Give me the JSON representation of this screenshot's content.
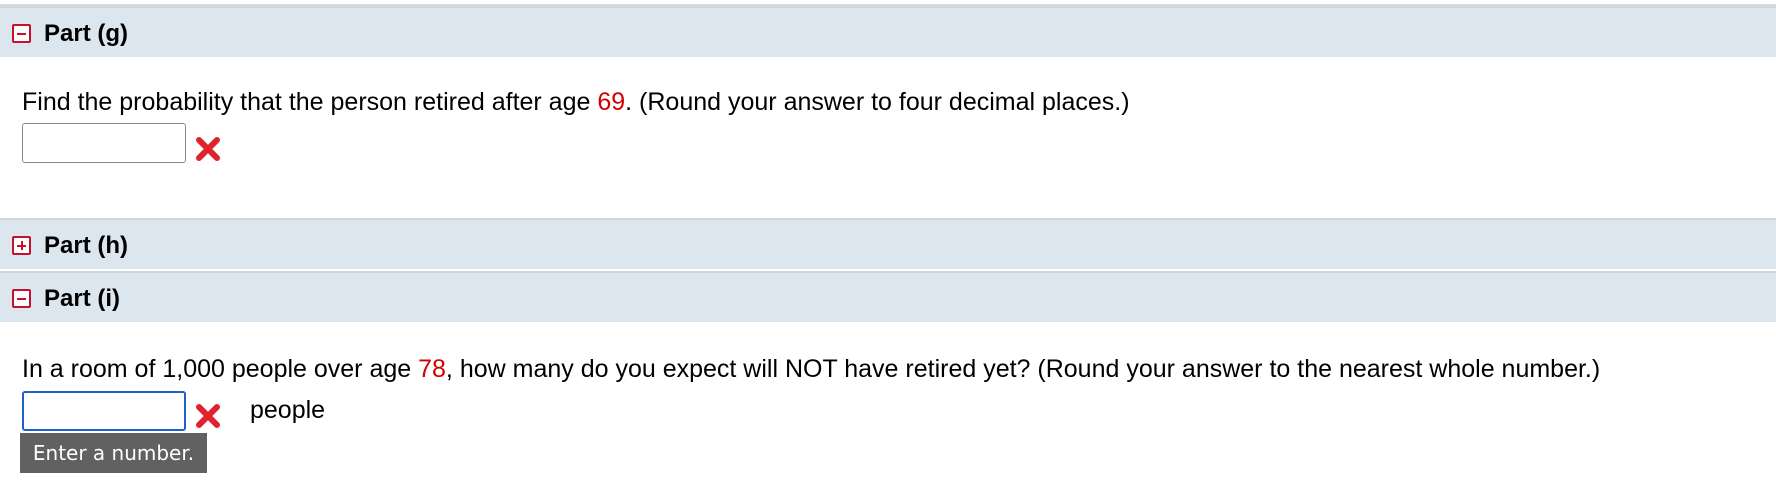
{
  "parts": [
    {
      "title": "Part (g)",
      "expanded": true,
      "question": {
        "before": "Find the probability that the person retired after age ",
        "highlight": "69",
        "after": ". (Round your answer to four decimal places.)"
      },
      "answer": {
        "value": "",
        "placeholder": ""
      },
      "status_icon": "red-x-icon"
    },
    {
      "title": "Part (h)",
      "expanded": false
    },
    {
      "title": "Part (i)",
      "expanded": true,
      "question": {
        "before": "In a room of 1,000 people over age ",
        "highlight": "78",
        "after": ", how many do you expect will NOT have retired yet? (Round your answer to the nearest whole number.)"
      },
      "answer": {
        "value": "",
        "placeholder": ""
      },
      "unit": "people",
      "status_icon": "red-x-icon",
      "tooltip": "Enter a number."
    }
  ],
  "colors": {
    "header_bg": "#dce6ef",
    "highlight_red": "#d00000",
    "toggle_red": "#c8102e",
    "focus_blue": "#1f5fd1",
    "tooltip_bg": "#616161"
  }
}
